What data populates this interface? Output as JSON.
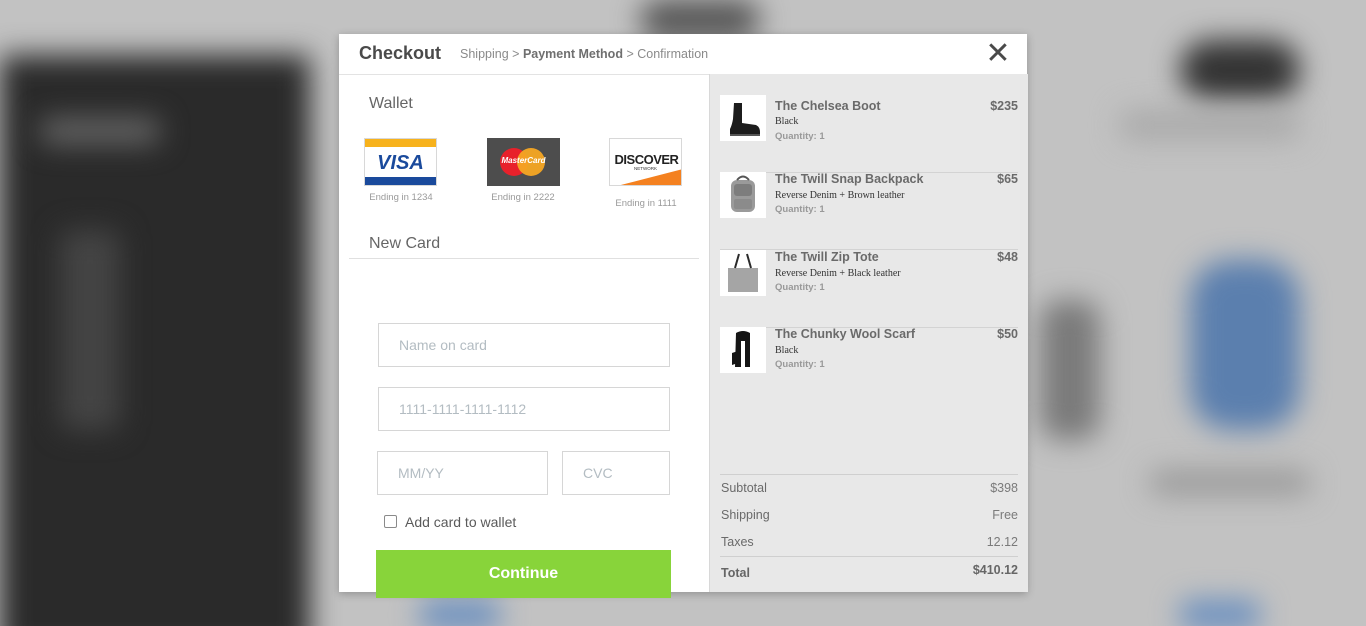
{
  "header": {
    "title": "Checkout",
    "breadcrumb": {
      "step1": "Shipping",
      "sep1": ">",
      "step2": "Payment Method",
      "sep2": ">",
      "step3": "Confirmation"
    },
    "close_icon": "close-icon",
    "close_glyph": "✕"
  },
  "wallet": {
    "title": "Wallet",
    "cards": [
      {
        "brand": "VISA",
        "ending": "Ending in 1234"
      },
      {
        "brand": "MasterCard",
        "ending": "Ending in 2222"
      },
      {
        "brand": "DISCOVER",
        "subbrand": "NETWORK",
        "ending": "Ending in 1111"
      }
    ]
  },
  "new_card": {
    "title": "New Card",
    "name_placeholder": "Name on card",
    "number_placeholder": "1111-1111-1111-1112",
    "expiry_placeholder": "MM/YY",
    "cvc_placeholder": "CVC",
    "add_to_wallet_label": "Add card to wallet",
    "add_to_wallet_checked": false,
    "continue_label": "Continue"
  },
  "cart": {
    "items": [
      {
        "name": "The Chelsea Boot",
        "variant": "Black",
        "quantity": "Quantity: 1",
        "price": "$235"
      },
      {
        "name": "The Twill Snap Backpack",
        "variant": "Reverse Denim + Brown leather",
        "quantity": "Quantity: 1",
        "price": "$65"
      },
      {
        "name": "The Twill Zip Tote",
        "variant": "Reverse Denim + Black leather",
        "quantity": "Quantity: 1",
        "price": "$48"
      },
      {
        "name": "The Chunky Wool Scarf",
        "variant": "Black",
        "quantity": "Quantity: 1",
        "price": "$50"
      }
    ],
    "summary": {
      "subtotal_label": "Subtotal",
      "subtotal_value": "$398",
      "shipping_label": "Shipping",
      "shipping_value": "Free",
      "taxes_label": "Taxes",
      "taxes_value": "12.12",
      "total_label": "Total",
      "total_value": "$410.12"
    }
  },
  "colors": {
    "continue_button": "#88d43a",
    "summary_background": "#e8e8e8"
  }
}
